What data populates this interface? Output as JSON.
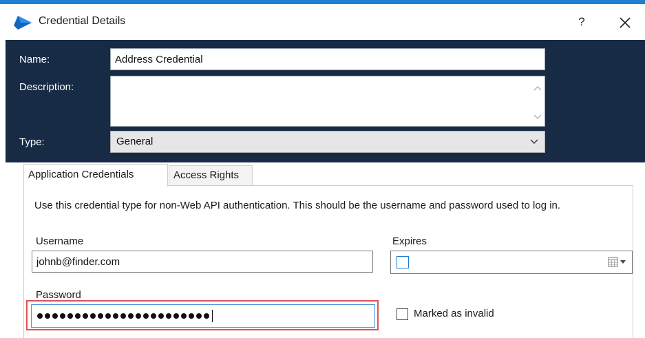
{
  "window": {
    "title": "Credential Details",
    "help_label": "?",
    "logo_icon": "app-logo-icon",
    "close_icon": "close-icon"
  },
  "header": {
    "name_label": "Name:",
    "name_value": "Address Credential",
    "description_label": "Description:",
    "description_value": "",
    "type_label": "Type:",
    "type_value": "General",
    "background_color": "#172b45"
  },
  "tabs": [
    {
      "label": "Application Credentials",
      "active": true
    },
    {
      "label": "Access Rights",
      "active": false
    }
  ],
  "panel": {
    "description": "Use this credential type for non-Web API authentication. This should be the username and password used to log in.",
    "username_label": "Username",
    "username_value": "johnb@finder.com",
    "expires_label": "Expires",
    "expires_checked": false,
    "password_label": "Password",
    "password_mask_length": 23,
    "marked_invalid_label": "Marked as invalid",
    "marked_invalid_checked": false,
    "highlight_color": "#e05252"
  }
}
